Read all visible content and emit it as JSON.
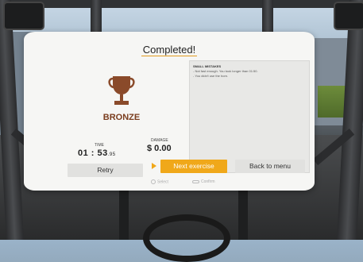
{
  "panel": {
    "title": "Completed!",
    "rank": "BRONZE",
    "mistakes": {
      "heading": "SMALL MISTAKES",
      "items": [
        "- Not fast enough. You took longer than 01:50.",
        "- You didn't use the horn."
      ]
    },
    "time": {
      "label": "TIME",
      "value": "01 : 53",
      "fraction": ".95"
    },
    "damage": {
      "label": "DAMAGE",
      "value": "$ 0.00"
    },
    "buttons": {
      "retry": "Retry",
      "next": "Next exercise",
      "menu": "Back to menu"
    },
    "hints": {
      "select": "Select",
      "confirm": "Confirm"
    }
  },
  "colors": {
    "accent": "#f0a81a",
    "bronze": "#7a3d1e",
    "panel_bg": "#f6f6f4"
  },
  "icons": {
    "trophy": "trophy-icon",
    "select": "thumbstick-icon",
    "confirm": "controller-trigger-icon"
  }
}
